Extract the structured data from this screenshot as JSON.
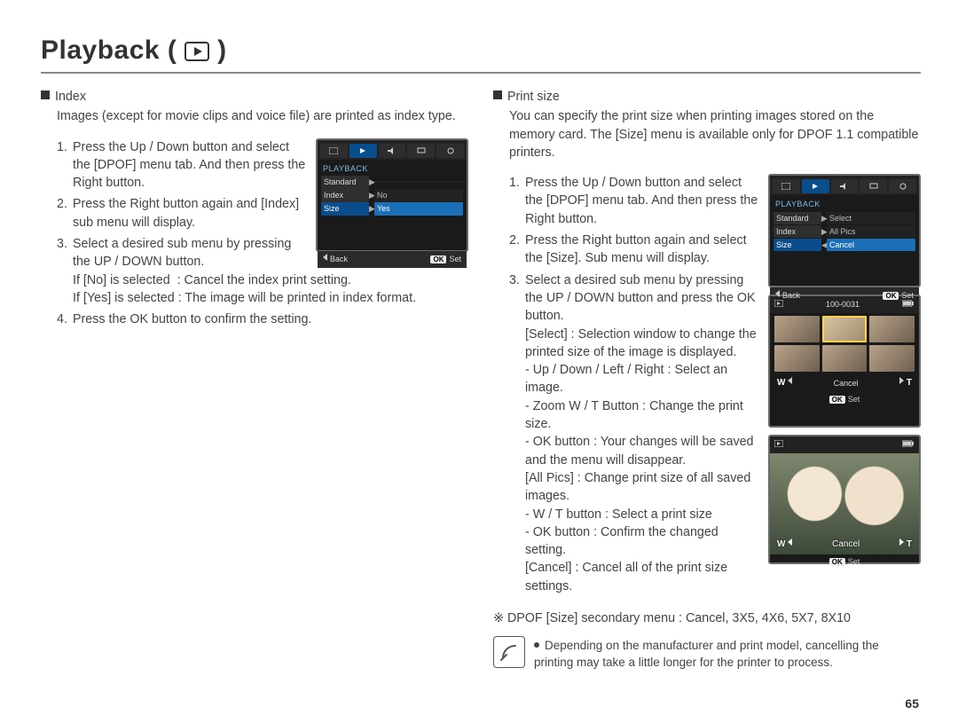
{
  "page_number": "65",
  "title": "Playback (",
  "title_close": ")",
  "left": {
    "heading": "Index",
    "desc": "Images (except for movie clips and voice file) are printed as index type.",
    "steps": {
      "s1": "Press the Up / Down button and select the [DPOF] menu tab. And then press the Right button.",
      "s2": "Press the Right button again and [Index] sub menu will display.",
      "s3": "Select a desired sub menu by pressing the UP / DOWN button.",
      "s3a": "If [No] is selected  : Cancel the index print setting.",
      "s3b": "If [Yes] is selected : The image will be printed in index format.",
      "s4": "Press the OK button to confirm the setting."
    },
    "screen": {
      "label": "PLAYBACK",
      "rows": [
        {
          "l": "Standard",
          "r": ""
        },
        {
          "l": "Index",
          "r": "No"
        },
        {
          "l": "Size",
          "r": "Yes"
        }
      ],
      "back": "Back",
      "set": "Set"
    }
  },
  "right": {
    "heading": "Print size",
    "desc": "You can specify the print size when printing images stored on the memory card. The [Size] menu is available only for DPOF 1.1 compatible printers.",
    "steps": {
      "s1": "Press the Up / Down button and select the [DPOF] menu tab. And then press the Right button.",
      "s2": "Press the Right button again and select the [Size]. Sub menu will display.",
      "s3": "Select a desired sub menu by pressing the UP / DOWN button and press the OK button.",
      "select_label": "[Select] : Selection window to change the printed size of the image is displayed.",
      "sel_a": "- Up / Down / Left / Right : Select an image.",
      "sel_b": "- Zoom W / T Button : Change the print size.",
      "sel_c": "- OK button : Your changes will be saved and the menu will disappear.",
      "allpics": "[All Pics] : Change print size of all saved images.",
      "all_a": "- W / T button : Select a print size",
      "all_b": "- OK button : Confirm the changed setting.",
      "cancel": "[Cancel] : Cancel all of the print size settings."
    },
    "secondary": "※ DPOF [Size] secondary menu : Cancel, 3X5, 4X6, 5X7, 8X10",
    "note": "Depending on the manufacturer and print model, cancelling the printing may take a little longer for the printer to process.",
    "screen1": {
      "label": "PLAYBACK",
      "rows": [
        {
          "l": "Standard",
          "r": "Select"
        },
        {
          "l": "Index",
          "r": "All Pics"
        },
        {
          "l": "Size",
          "r": "Cancel"
        }
      ],
      "back": "Back",
      "set": "Set"
    },
    "screen2": {
      "counter": "100-0031",
      "w": "W",
      "t": "T",
      "cancel": "Cancel",
      "set": "Set"
    },
    "screen3": {
      "w": "W",
      "t": "T",
      "cancel": "Cancel",
      "set": "Set"
    }
  }
}
